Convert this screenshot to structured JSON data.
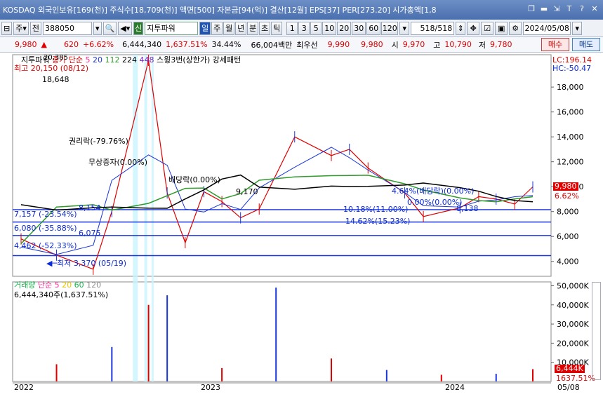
{
  "title_bar": {
    "text": "KOSDAQ 외국인보유[169(천)] 주식수[18,709(천)] 액면[500] 자본금[94(억)] 결산[12월] EPS[37] PER[273.20] 시가총액[1,8",
    "icons": [
      "window-restore-icon",
      "window-minimize-icon",
      "window-link-icon",
      "window-font-icon",
      "help-icon",
      "close-icon"
    ]
  },
  "toolbar": {
    "market": "주",
    "scope": "전",
    "code": "388050",
    "company": "지투파워",
    "company_tag": "신",
    "periods": [
      "일",
      "주",
      "월",
      "년",
      "분",
      "초",
      "틱"
    ],
    "intervals": [
      "1",
      "3",
      "5",
      "10",
      "20",
      "30",
      "60",
      "120"
    ],
    "page": "518/518",
    "date": "2024/05/08"
  },
  "info_bar": {
    "price": "9,980",
    "change": "620",
    "change_pct": "+6.62%",
    "volume": "6,444,340",
    "volume_pct": "1,637.51%",
    "turnover": "34.44%",
    "amount": "66,004백만",
    "best_ask_label": "최우선",
    "best_ask": "9,990",
    "best_bid": "9,980",
    "open_label": "시",
    "open": "9,970",
    "high_label": "고",
    "high": "10,790",
    "low_label": "저",
    "low": "9,780",
    "buy": "매수",
    "sell": "매도"
  },
  "price_panel": {
    "indicator_title": "지투파워",
    "ma_label": "종가 단순",
    "ma_periods": [
      "5",
      "20",
      "112",
      "224",
      "448"
    ],
    "ma_colors": [
      "#ff2e9a",
      "#1b37d9",
      "#2e9b2a",
      "#000000",
      "#7a27c9"
    ],
    "pattern_title": "스윙3번(상한가) 강세패턴",
    "lc": "LC:196.14",
    "hc": "HC:-50.47",
    "high_peak": "20,385",
    "annotations": [
      {
        "text": "최고 20,150 (08/12)",
        "color": "#e00000"
      },
      {
        "text": "18,648",
        "color": "#000000"
      },
      {
        "text": "권리락(-79.76%)",
        "color": "#000000"
      },
      {
        "text": "무상증자(0.00%)",
        "color": "#000000"
      },
      {
        "text": "배당락(0.00%)",
        "color": "#000000"
      },
      {
        "text": "8,154",
        "color": "#1b37d9"
      },
      {
        "text": "7,157 (-23.54%)",
        "color": "#1b37d9"
      },
      {
        "text": "6,080 (-35.88%)",
        "color": "#1b37d9"
      },
      {
        "text": "6,075",
        "color": "#1b37d9"
      },
      {
        "text": "4,462 (-52.33%)",
        "color": "#1b37d9"
      },
      {
        "text": "최저 3,370 (05/19)",
        "color": "#1b37d9"
      },
      {
        "text": "9,170",
        "color": "#000000"
      },
      {
        "text": "4.64%(배당락)(0.00%)",
        "color": "#1b37d9"
      },
      {
        "text": "0.00%(0.00%)",
        "color": "#1b37d9"
      },
      {
        "text": "8,138",
        "color": "#1b37d9"
      },
      {
        "text": "10.18%(11.00%)",
        "color": "#1b37d9"
      },
      {
        "text": "14.62%(15.23%)",
        "color": "#1b37d9"
      }
    ],
    "price_badge": "9,980",
    "pct_badge": "6.62%"
  },
  "volume_panel": {
    "title": "거래량",
    "ma_label": "단순",
    "ma_periods": [
      "5",
      "20",
      "60",
      "120"
    ],
    "ma_colors": [
      "#ff2e9a",
      "#e8c600",
      "#1ab54b",
      "#8c8c8c"
    ],
    "readout": "6,444,340주(1,637.51%)",
    "badge_volume": "6,444K",
    "badge_pct": "1637.51%"
  },
  "x_axis": [
    "2022",
    "2023",
    "2024",
    "05/08"
  ],
  "chart_data": [
    {
      "type": "line",
      "title": "",
      "y_axis_ticks": [
        4000,
        6000,
        8000,
        10000,
        12000,
        14000,
        16000,
        18000
      ],
      "ylim": [
        2800,
        20600
      ],
      "x": [
        "2022-01",
        "2022-03",
        "2022-05",
        "2022-06",
        "2022-08",
        "2022-09",
        "2022-10",
        "2022-11",
        "2022-12",
        "2023-01",
        "2023-02",
        "2023-04",
        "2023-06",
        "2023-07",
        "2023-08",
        "2023-10",
        "2023-11",
        "2024-01",
        "2024-02",
        "2024-03",
        "2024-04",
        "2024-05"
      ],
      "series": [
        {
          "name": "종가",
          "values": [
            5800,
            4500,
            3370,
            8000,
            20150,
            9500,
            5500,
            9600,
            8800,
            7500,
            8200,
            14000,
            12500,
            13000,
            11500,
            9500,
            7600,
            8300,
            9200,
            9000,
            8600,
            9980
          ]
        }
      ],
      "support_lines": [
        8154,
        7157,
        6075,
        4462
      ]
    },
    {
      "type": "bar",
      "title": "",
      "y_axis_ticks": [
        "10,000K",
        "20,000K",
        "30,000K",
        "40,000K",
        "50,000K"
      ],
      "ylim": [
        0,
        52000
      ],
      "x": [
        "2022-03",
        "2022-06",
        "2022-08",
        "2022-09",
        "2022-12",
        "2023-03",
        "2023-06",
        "2023-09",
        "2023-12",
        "2024-03",
        "2024-05"
      ],
      "values": [
        9000,
        18000,
        40000,
        45000,
        7000,
        49000,
        12000,
        6000,
        3500,
        4000,
        6444
      ]
    }
  ]
}
